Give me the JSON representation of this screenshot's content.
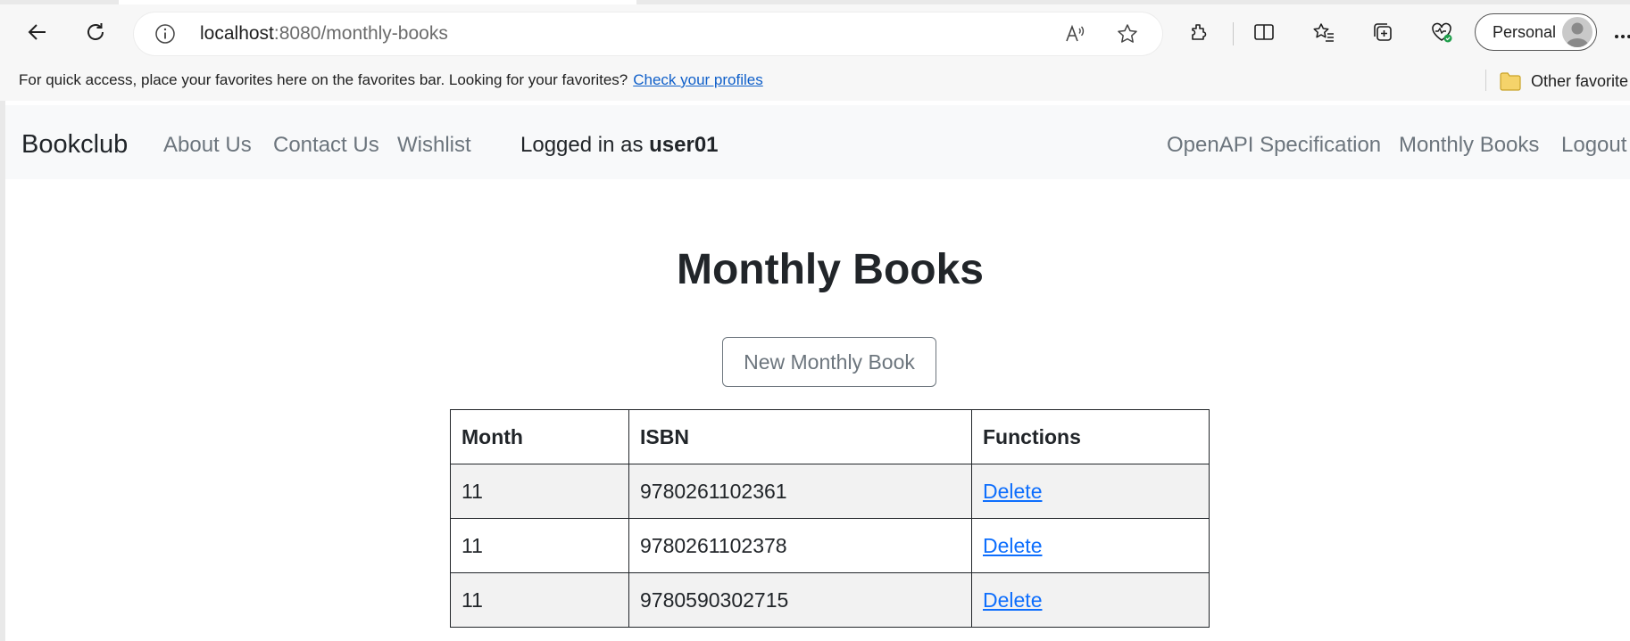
{
  "browser": {
    "url_host": "localhost",
    "url_path": ":8080/monthly-books",
    "profile_name": "Personal",
    "favorites_message": "For quick access, place your favorites here on the favorites bar. Looking for your favorites?",
    "favorites_link": "Check your profiles",
    "other_favorites": "Other favorite",
    "icons": [
      "back-icon",
      "refresh-icon",
      "info-icon",
      "read-aloud-icon",
      "favorite-star-icon",
      "extensions-icon",
      "split-screen-icon",
      "favorites-icon",
      "collections-icon",
      "browser-essentials-icon",
      "more-icon",
      "folder-icon"
    ]
  },
  "navbar": {
    "brand": "Bookclub",
    "links": [
      "About Us",
      "Contact Us",
      "Wishlist"
    ],
    "logged_in_prefix": "Logged in as",
    "username": "user01",
    "right_links": [
      "OpenAPI Specification",
      "Monthly Books",
      "Logout"
    ]
  },
  "main": {
    "title": "Monthly Books",
    "new_button": "New Monthly Book",
    "table": {
      "headers": [
        "Month",
        "ISBN",
        "Functions"
      ],
      "rows": [
        {
          "month": "11",
          "isbn": "9780261102361",
          "action": "Delete"
        },
        {
          "month": "11",
          "isbn": "9780261102378",
          "action": "Delete"
        },
        {
          "month": "11",
          "isbn": "9780590302715",
          "action": "Delete"
        }
      ]
    }
  }
}
